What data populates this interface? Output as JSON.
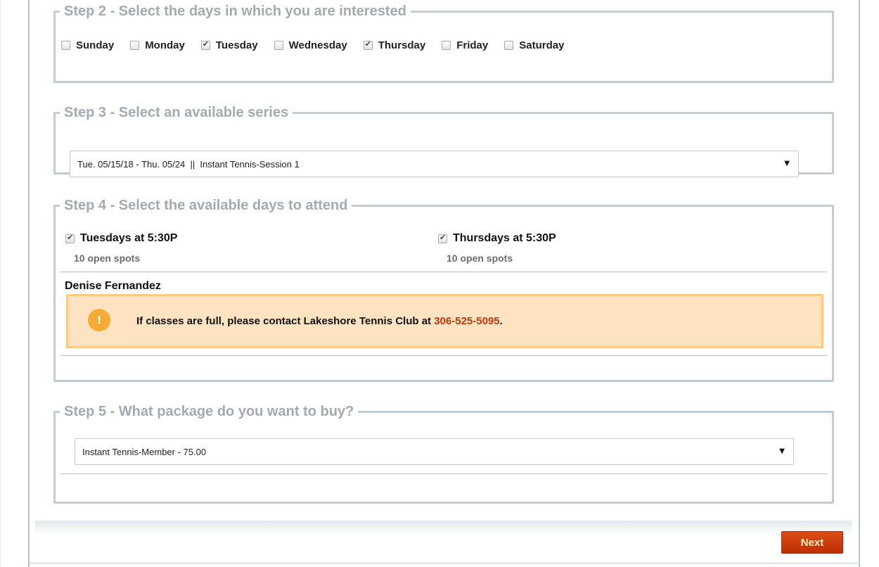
{
  "step2": {
    "legend": "Step 2 - Select the days in which you are interested",
    "days": [
      {
        "label": "Sunday",
        "checked": false
      },
      {
        "label": "Monday",
        "checked": false
      },
      {
        "label": "Tuesday",
        "checked": true
      },
      {
        "label": "Wednesday",
        "checked": false
      },
      {
        "label": "Thursday",
        "checked": true
      },
      {
        "label": "Friday",
        "checked": false
      },
      {
        "label": "Saturday",
        "checked": false
      }
    ]
  },
  "step3": {
    "legend": "Step 3 - Select an available series",
    "selected": "Tue. 05/15/18 - Thu. 05/24  ||  Instant Tennis-Session 1"
  },
  "step4": {
    "legend": "Step 4 - Select the available days to attend",
    "options": [
      {
        "label": "Tuesdays at 5:30P",
        "spots": "10 open spots",
        "checked": true
      },
      {
        "label": "Thursdays at 5:30P",
        "spots": "10 open spots",
        "checked": true
      }
    ],
    "member_name": "Denise Fernandez",
    "alert": {
      "icon": "warning-icon",
      "text": "If classes are full, please contact Lakeshore Tennis Club at ",
      "phone": "306-525-5095",
      "suffix": "."
    }
  },
  "step5": {
    "legend": "Step 5 - What package do you want to buy?",
    "selected": "Instant Tennis-Member - 75.00"
  },
  "footer": {
    "next_label": "Next"
  },
  "colors": {
    "legend": "#a3aab1",
    "border": "#c3ccd4",
    "alert_bg": "#fde3c2",
    "alert_border": "#fbca85",
    "alert_icon": "#f6ab35",
    "phone": "#c0390f",
    "next_button": "#c73a0b"
  }
}
